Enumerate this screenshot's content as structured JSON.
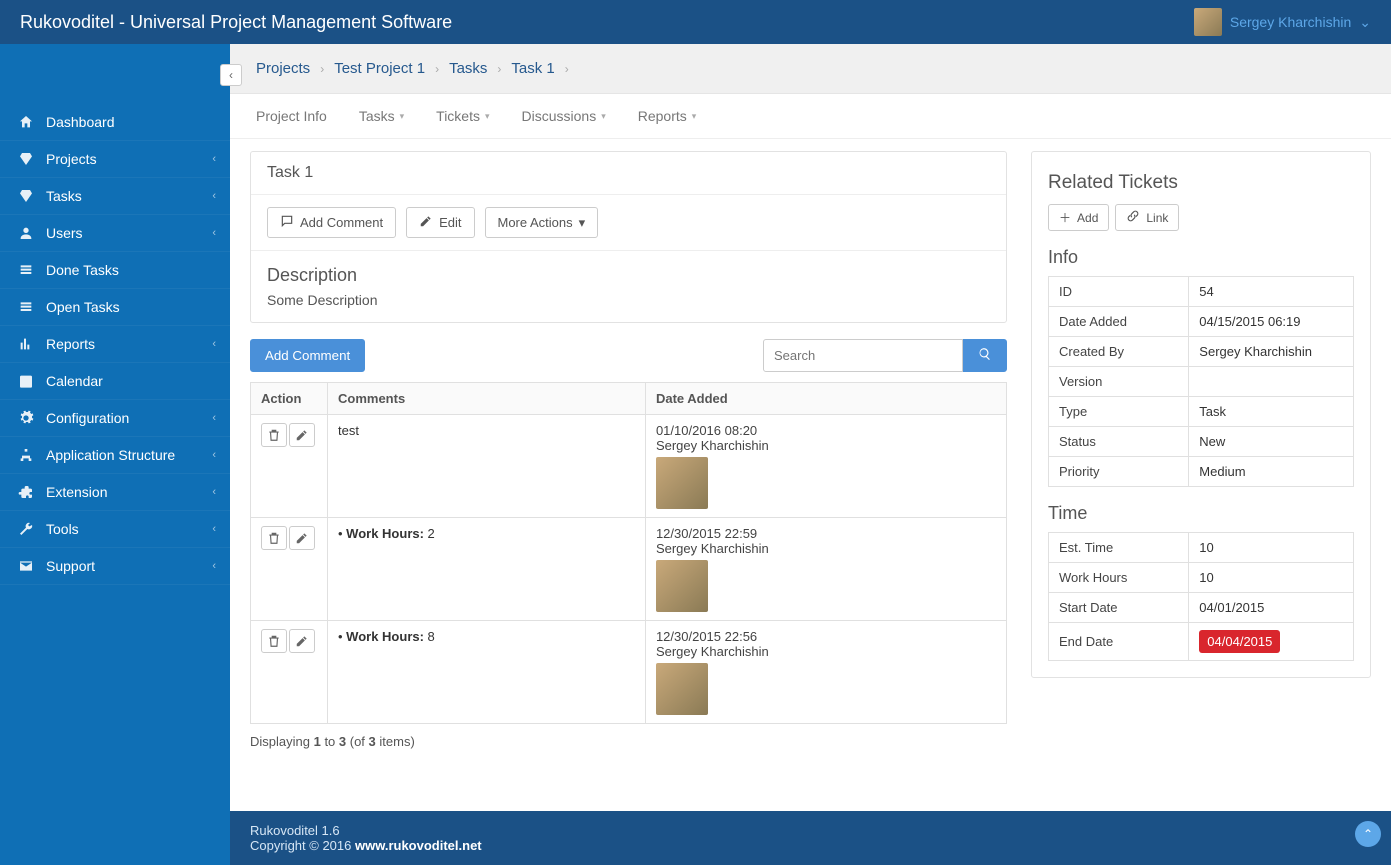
{
  "header": {
    "brand": "Rukovoditel - Universal Project Management Software",
    "user_name": "Sergey Kharchishin"
  },
  "sidebar": {
    "items": [
      {
        "label": "Dashboard",
        "has_sub": false
      },
      {
        "label": "Projects",
        "has_sub": true
      },
      {
        "label": "Tasks",
        "has_sub": true
      },
      {
        "label": "Users",
        "has_sub": true
      },
      {
        "label": "Done Tasks",
        "has_sub": false
      },
      {
        "label": "Open Tasks",
        "has_sub": false
      },
      {
        "label": "Reports",
        "has_sub": true
      },
      {
        "label": "Calendar",
        "has_sub": false
      },
      {
        "label": "Configuration",
        "has_sub": true
      },
      {
        "label": "Application Structure",
        "has_sub": true
      },
      {
        "label": "Extension",
        "has_sub": true
      },
      {
        "label": "Tools",
        "has_sub": true
      },
      {
        "label": "Support",
        "has_sub": true
      }
    ]
  },
  "breadcrumbs": [
    "Projects",
    "Test Project 1",
    "Tasks",
    "Task 1"
  ],
  "tabs": [
    {
      "label": "Project Info",
      "caret": false
    },
    {
      "label": "Tasks",
      "caret": true
    },
    {
      "label": "Tickets",
      "caret": true
    },
    {
      "label": "Discussions",
      "caret": true
    },
    {
      "label": "Reports",
      "caret": true
    }
  ],
  "task": {
    "title": "Task 1",
    "buttons": {
      "add_comment": "Add Comment",
      "edit": "Edit",
      "more": "More Actions"
    },
    "description_heading": "Description",
    "description_text": "Some Description"
  },
  "comments": {
    "add_label": "Add Comment",
    "search_placeholder": "Search",
    "headers": {
      "action": "Action",
      "comments": "Comments",
      "date_added": "Date Added"
    },
    "rows": [
      {
        "text": "test",
        "work_hours_label": "",
        "work_hours": "",
        "date": "01/10/2016 08:20",
        "author": "Sergey Kharchishin"
      },
      {
        "text": "",
        "work_hours_label": "Work Hours:",
        "work_hours": "2",
        "date": "12/30/2015 22:59",
        "author": "Sergey Kharchishin"
      },
      {
        "text": "",
        "work_hours_label": "Work Hours:",
        "work_hours": "8",
        "date": "12/30/2015 22:56",
        "author": "Sergey Kharchishin"
      }
    ],
    "pager_prefix": "Displaying ",
    "pager_from": "1",
    "pager_to_word": " to ",
    "pager_to": "3",
    "pager_of": " (of ",
    "pager_total": "3",
    "pager_suffix": " items)"
  },
  "side": {
    "related_title": "Related Tickets",
    "add_label": "Add",
    "link_label": "Link",
    "info_title": "Info",
    "info": {
      "id_label": "ID",
      "id": "54",
      "date_label": "Date Added",
      "date": "04/15/2015 06:19",
      "created_label": "Created By",
      "created": "Sergey Kharchishin",
      "version_label": "Version",
      "version": "",
      "type_label": "Type",
      "type": "Task",
      "status_label": "Status",
      "status": "New",
      "priority_label": "Priority",
      "priority": "Medium"
    },
    "time_title": "Time",
    "time": {
      "est_label": "Est. Time",
      "est": "10",
      "work_label": "Work Hours",
      "work": "10",
      "start_label": "Start Date",
      "start": "04/01/2015",
      "end_label": "End Date",
      "end": "04/04/2015"
    }
  },
  "footer": {
    "line1": "Rukovoditel 1.6",
    "line2_prefix": "Copyright © 2016 ",
    "line2_link": "www.rukovoditel.net"
  }
}
